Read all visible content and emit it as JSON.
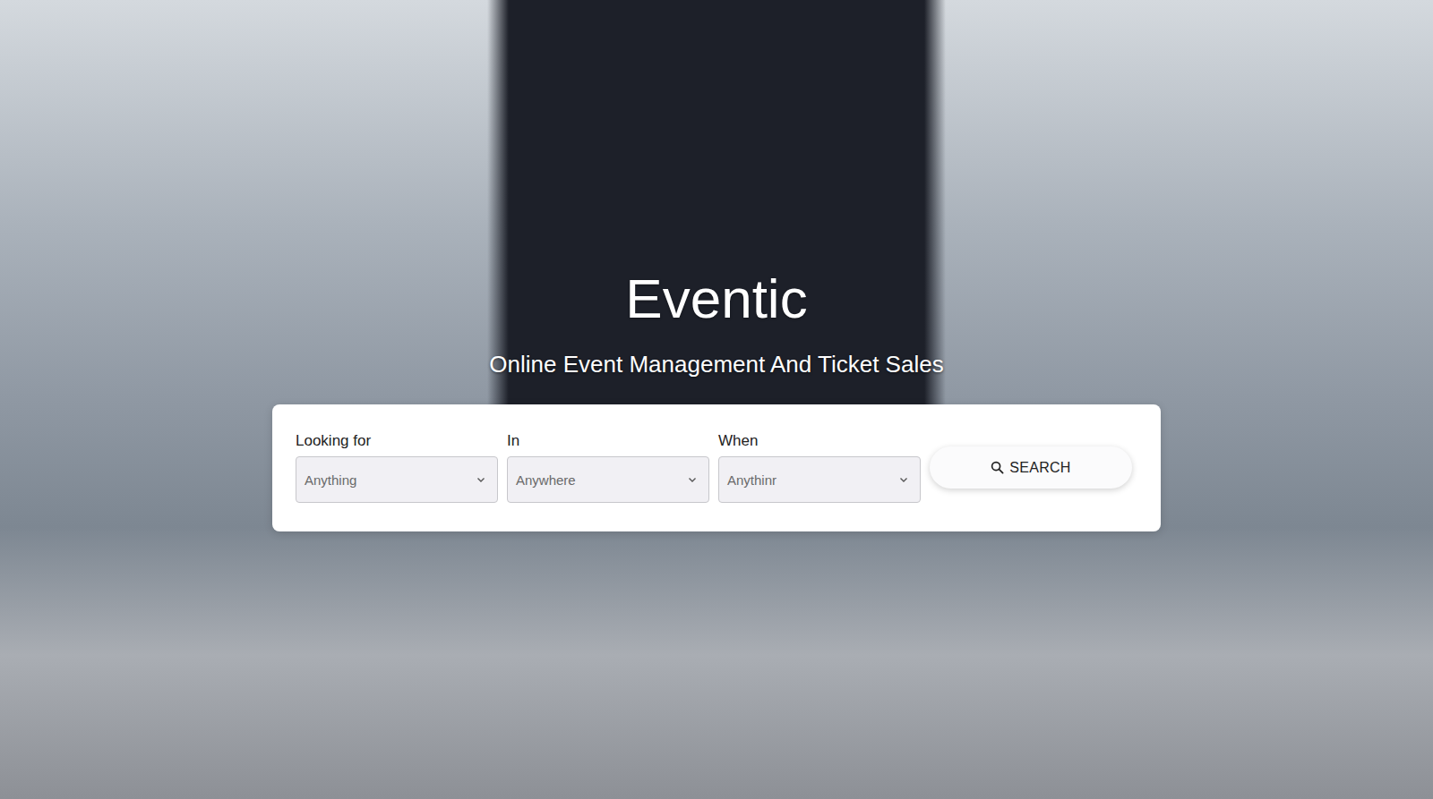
{
  "brand": {
    "title": "Eventic",
    "tagline": "Online Event Management And Ticket Sales"
  },
  "search": {
    "fields": [
      {
        "label": "Looking for",
        "value": "Anything"
      },
      {
        "label": "In",
        "value": "Anywhere"
      },
      {
        "label": "When",
        "value": "Anythinr"
      }
    ],
    "button": {
      "label": "SEARCH"
    }
  }
}
